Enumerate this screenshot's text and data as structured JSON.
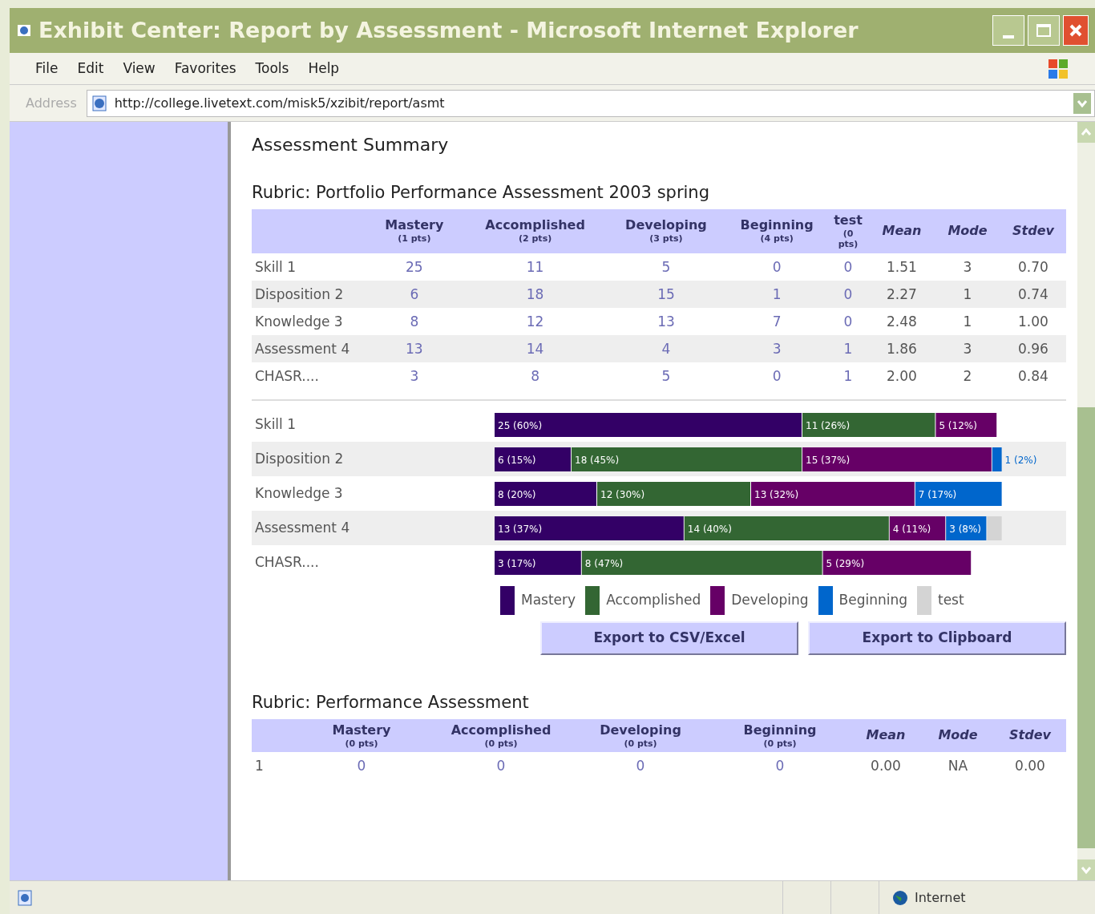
{
  "window": {
    "title": "Exhibit Center: Report by Assessment - Microsoft Internet Explorer"
  },
  "menu": [
    "File",
    "Edit",
    "View",
    "Favorites",
    "Tools",
    "Help"
  ],
  "address": {
    "label": "Address",
    "url": "http://college.livetext.com/misk5/xzibit/report/asmt"
  },
  "heading": "Assessment Summary",
  "rubrics": [
    {
      "title": "Rubric: Portfolio Performance Assessment 2003 spring",
      "columns": [
        {
          "kind": "level",
          "label": "Mastery",
          "points": "(1 pts)"
        },
        {
          "kind": "level",
          "label": "Accomplished",
          "points": "(2 pts)"
        },
        {
          "kind": "level",
          "label": "Developing",
          "points": "(3 pts)"
        },
        {
          "kind": "level",
          "label": "Beginning",
          "points": "(4 pts)"
        },
        {
          "kind": "narrow",
          "label": "test",
          "points": "(0 pts)"
        },
        {
          "kind": "stat",
          "label": "Mean"
        },
        {
          "kind": "stat",
          "label": "Mode"
        },
        {
          "kind": "stat",
          "label": "Stdev"
        }
      ],
      "rows": [
        {
          "name": "Skill 1",
          "cells": [
            "25",
            "11",
            "5",
            "0",
            "0",
            "1.51",
            "3",
            "0.70"
          ]
        },
        {
          "name": "Disposition 2",
          "cells": [
            "6",
            "18",
            "15",
            "1",
            "0",
            "2.27",
            "1",
            "0.74"
          ]
        },
        {
          "name": "Knowledge 3",
          "cells": [
            "8",
            "12",
            "13",
            "7",
            "0",
            "2.48",
            "1",
            "1.00"
          ]
        },
        {
          "name": "Assessment 4",
          "cells": [
            "13",
            "14",
            "4",
            "3",
            "1",
            "1.86",
            "3",
            "0.96"
          ]
        },
        {
          "name": "CHASR....",
          "cells": [
            "3",
            "8",
            "5",
            "0",
            "1",
            "2.00",
            "2",
            "0.84"
          ]
        }
      ],
      "chart_data": {
        "type": "bar",
        "orientation": "horizontal",
        "stacked": true,
        "data_labels": true,
        "legend": "bottom",
        "categories": [
          "Skill 1",
          "Disposition 2",
          "Knowledge 3",
          "Assessment 4",
          "CHASR...."
        ],
        "series": [
          {
            "name": "Mastery",
            "color": "#330066",
            "values": [
              60,
              15,
              20,
              37,
              17
            ],
            "value_labels": [
              "25 (60%)",
              "6 (15%)",
              "8 (20%)",
              "13 (37%)",
              "3 (17%)"
            ]
          },
          {
            "name": "Accomplished",
            "color": "#336633",
            "values": [
              26,
              45,
              30,
              40,
              47
            ],
            "value_labels": [
              "11 (26%)",
              "18 (45%)",
              "12 (30%)",
              "14 (40%)",
              "8 (47%)"
            ]
          },
          {
            "name": "Developing",
            "color": "#660066",
            "values": [
              12,
              37,
              32,
              11,
              29
            ],
            "value_labels": [
              "5 (12%)",
              "15 (37%)",
              "13 (32%)",
              "4 (11%)",
              "5 (29%)"
            ]
          },
          {
            "name": "Beginning",
            "color": "#0066cc",
            "values": [
              null,
              2,
              17,
              8,
              null
            ],
            "value_labels": [
              null,
              "1 (2%)",
              "7 (17%)",
              "3 (8%)",
              null
            ]
          },
          {
            "name": "test",
            "color": "#d4d4d4",
            "values": [
              null,
              null,
              null,
              3,
              null
            ],
            "value_labels": [
              null,
              null,
              null,
              null,
              null
            ]
          }
        ]
      },
      "buttons": [
        "Export to CSV/Excel",
        "Export to Clipboard"
      ]
    },
    {
      "title": "Rubric: Performance Assessment",
      "columns": [
        {
          "kind": "level",
          "label": "Mastery",
          "points": "(0 pts)"
        },
        {
          "kind": "level",
          "label": "Accomplished",
          "points": "(0 pts)"
        },
        {
          "kind": "level",
          "label": "Developing",
          "points": "(0 pts)"
        },
        {
          "kind": "level",
          "label": "Beginning",
          "points": "(0 pts)"
        },
        {
          "kind": "stat",
          "label": "Mean"
        },
        {
          "kind": "stat",
          "label": "Mode"
        },
        {
          "kind": "stat",
          "label": "Stdev"
        }
      ],
      "rows": [
        {
          "name": "1",
          "cells": [
            "0",
            "0",
            "0",
            "0",
            "0.00",
            "NA",
            "0.00"
          ]
        }
      ]
    }
  ],
  "status_bar": {
    "zone": "Internet"
  }
}
